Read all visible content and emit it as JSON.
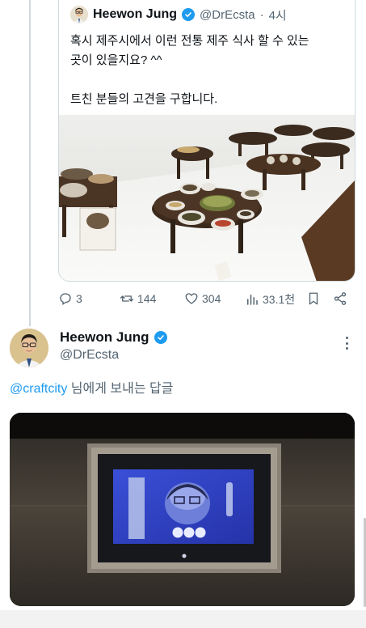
{
  "quoted_tweet": {
    "author_name": "Heewon Jung",
    "author_handle": "@DrEcsta",
    "dot": "·",
    "time": "4시",
    "text_line1": "혹시 제주시에서 이런 전통 제주 식사 할 수 있는",
    "text_line2": "곳이 있을지요? ^^",
    "text_line3": "트친 분들의 고견을 구합니다."
  },
  "actions": {
    "replies": "3",
    "retweets": "144",
    "likes": "304",
    "views": "33.1천"
  },
  "reply": {
    "author_name": "Heewon Jung",
    "author_handle": "@DrEcsta",
    "reply_mention": "@craftcity",
    "reply_suffix": " 님에게 보내는 답글"
  },
  "icons": [
    "verified-badge-icon",
    "reply-icon",
    "retweet-icon",
    "like-icon",
    "views-icon",
    "bookmark-icon",
    "share-icon",
    "more-icon"
  ],
  "colors": {
    "accent": "#1d9bf0",
    "secondary_text": "#536471",
    "border": "#cfd9de"
  }
}
